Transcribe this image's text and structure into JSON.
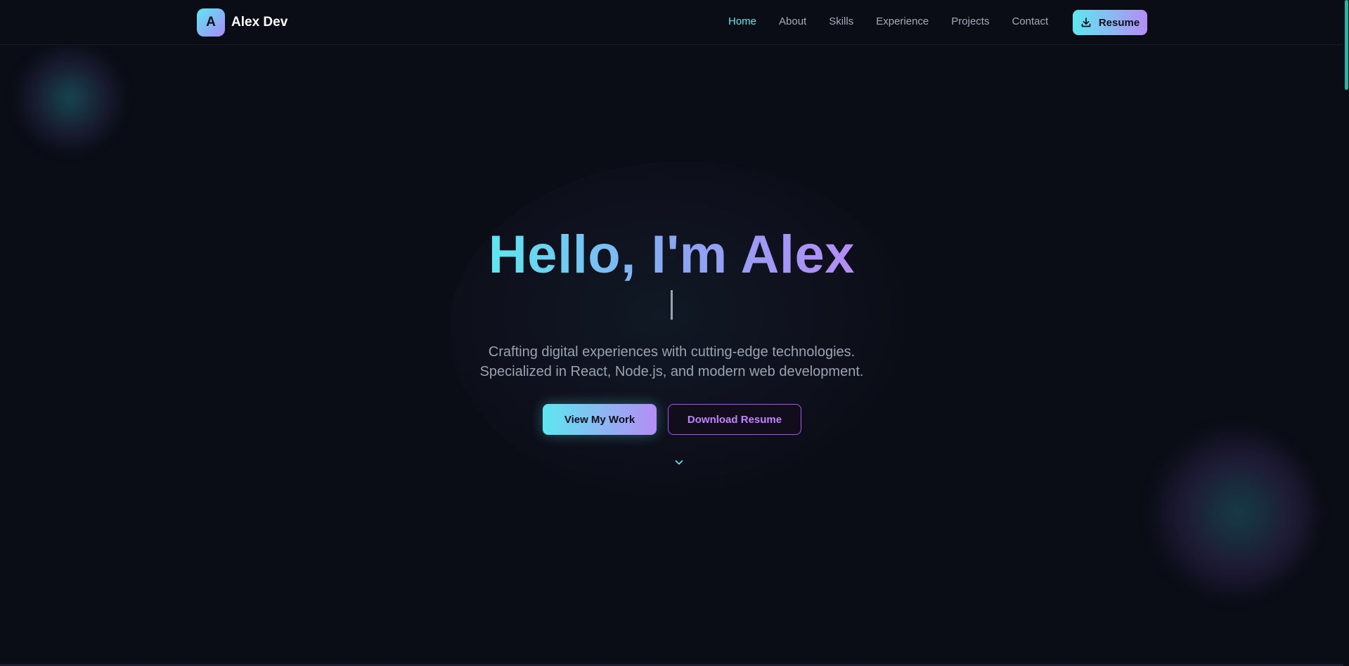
{
  "brand": {
    "initial": "A",
    "name": "Alex Dev"
  },
  "nav": {
    "items": [
      {
        "label": "Home",
        "active": true
      },
      {
        "label": "About",
        "active": false
      },
      {
        "label": "Skills",
        "active": false
      },
      {
        "label": "Experience",
        "active": false
      },
      {
        "label": "Projects",
        "active": false
      },
      {
        "label": "Contact",
        "active": false
      }
    ],
    "resume_label": "Resume",
    "resume_icon": "download-icon"
  },
  "hero": {
    "title": "Hello, I'm Alex",
    "description_line1": "Crafting digital experiences with cutting-edge technologies.",
    "description_line2": "Specialized in React, Node.js, and modern web development.",
    "primary_cta": "View My Work",
    "secondary_cta": "Download Resume",
    "scroll_icon": "chevron-down-icon"
  },
  "colors": {
    "background": "#0a0d16",
    "accent_cyan": "#5ee7f0",
    "accent_purple": "#b48df5",
    "outline_purple": "#a855f7",
    "muted_text": "#9aa3b2"
  }
}
